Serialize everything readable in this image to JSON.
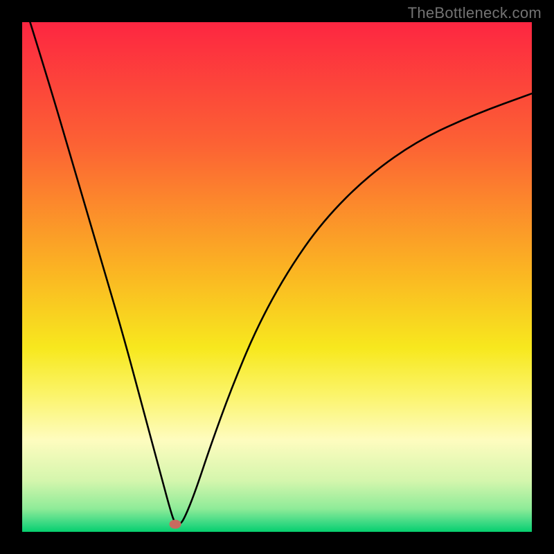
{
  "watermark": "TheBottleneck.com",
  "colors": {
    "black": "#000000",
    "curve": "#000000",
    "marker": "#c76b5f",
    "gradient_stops": [
      {
        "offset": 0,
        "color": "#fd2641"
      },
      {
        "offset": 0.24,
        "color": "#fc6234"
      },
      {
        "offset": 0.48,
        "color": "#fbb223"
      },
      {
        "offset": 0.64,
        "color": "#f7e81e"
      },
      {
        "offset": 0.73,
        "color": "#fbf469"
      },
      {
        "offset": 0.82,
        "color": "#fefcbf"
      },
      {
        "offset": 0.9,
        "color": "#d4f6ad"
      },
      {
        "offset": 0.955,
        "color": "#8eeb98"
      },
      {
        "offset": 0.985,
        "color": "#33d881"
      },
      {
        "offset": 1.0,
        "color": "#06cf6e"
      }
    ]
  },
  "chart_data": {
    "type": "line",
    "title": "",
    "xlabel": "",
    "ylabel": "",
    "xlim": [
      0,
      100
    ],
    "ylim": [
      0,
      100
    ],
    "series": [
      {
        "name": "bottleneck-curve",
        "x": [
          0,
          5,
          10,
          15,
          20,
          24,
          27,
          29,
          30,
          31,
          32,
          34,
          37,
          41,
          46,
          52,
          59,
          68,
          78,
          89,
          100
        ],
        "y": [
          105,
          89,
          72,
          55,
          38,
          23,
          12,
          4.5,
          1.5,
          1.4,
          3,
          8,
          17,
          28,
          40,
          51,
          61,
          70,
          77,
          82,
          86
        ]
      }
    ],
    "annotations": [
      {
        "name": "min-marker",
        "x": 30,
        "y": 1.5
      }
    ]
  }
}
